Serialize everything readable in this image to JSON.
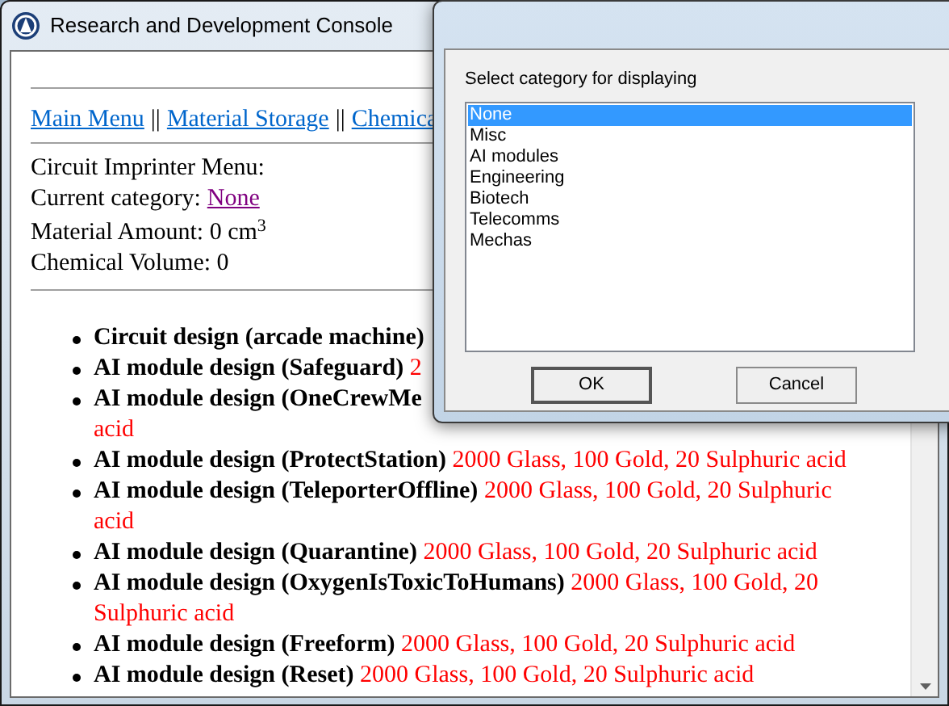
{
  "window": {
    "title": "Research and Development Console"
  },
  "nav_links": [
    {
      "label": "Main Menu"
    },
    {
      "label": "Material Storage"
    },
    {
      "label": "Chemica"
    }
  ],
  "nav_separator": "||",
  "info": {
    "menu_title": "Circuit Imprinter Menu:",
    "category_label": "Current category:",
    "category_value": "None",
    "material_label": "Material Amount: 0 cm",
    "material_unit_power": "3",
    "chemical_volume": "Chemical Volume: 0"
  },
  "designs": [
    {
      "text": "**Circuit design (arcade machine)**"
    },
    {
      "text": "**AI module design (Safeguard)** 2"
    },
    {
      "text": "**AI module design (OneCrewMe**",
      "continuation": "acid"
    },
    {
      "text": "**AI module design (ProtectStation)** 2000 Glass, 100 Gold, 20 Sulphuric acid"
    },
    {
      "text": "**AI module design (TeleporterOffline)** 2000 Glass, 100 Gold, 20 Sulphuric acid"
    },
    {
      "text": "**AI module design (Quarantine)** 2000 Glass, 100 Gold, 20 Sulphuric acid"
    },
    {
      "text": "**AI module design (OxygenIsToxicToHumans)** 2000 Glass, 100 Gold, 20 Sulphuric acid"
    },
    {
      "text": "**AI module design (Freeform)** 2000 Glass, 100 Gold, 20 Sulphuric acid"
    },
    {
      "text": "**AI module design (Reset)** 2000 Glass, 100 Gold, 20 Sulphuric acid"
    }
  ],
  "dialog": {
    "prompt": "Select category for displaying",
    "options": [
      {
        "label": "None",
        "selected": true
      },
      {
        "label": "Misc",
        "selected": false
      },
      {
        "label": "AI modules",
        "selected": false
      },
      {
        "label": "Engineering",
        "selected": false
      },
      {
        "label": "Biotech",
        "selected": false
      },
      {
        "label": "Telecomms",
        "selected": false
      },
      {
        "label": "Mechas",
        "selected": false
      }
    ],
    "buttons": [
      {
        "label": "OK",
        "default": true
      },
      {
        "label": "Cancel",
        "default": false
      }
    ]
  }
}
